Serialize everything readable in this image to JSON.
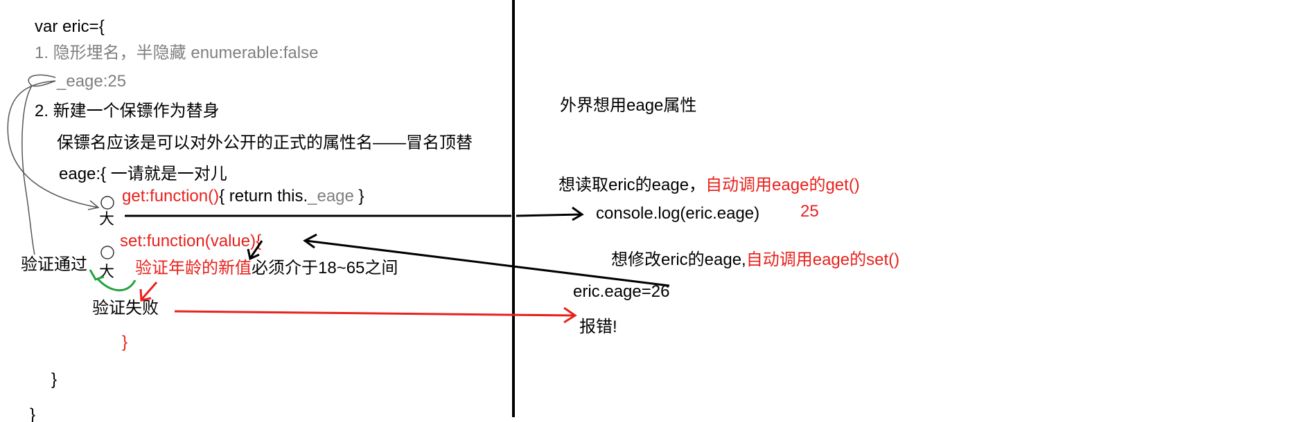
{
  "code": {
    "open": "var eric={",
    "note1": "1. 隐形埋名，半隐藏 enumerable:false",
    "prop": "_eage:25",
    "note2": "2. 新建一个保镖作为替身",
    "note2_detail": "保镖名应该是可以对外公开的正式的属性名——冒名顶替",
    "accessor_open": "eage:{ 一请就是一对儿",
    "getter_prefix": "get:function()",
    "getter_body": "{ return this.",
    "getter_field": "_eage",
    "getter_close": " }",
    "setter": "set:function(value){",
    "validate_red": "验证年龄的新值",
    "validate_black": "必须介于18~65之间",
    "pass_label": "验证通过",
    "fail_label": "验证失败",
    "setter_close": "}",
    "accessor_close": "}",
    "close": "}"
  },
  "outside": {
    "heading": "外界想用eage属性",
    "read_black": "想读取eric的eage，",
    "read_red": "自动调用eage的get()",
    "read_code": "console.log(eric.eage)",
    "read_result": "25",
    "write_black": "想修改eric的eage,",
    "write_red": "自动调用eage的set()",
    "write_code": "eric.eage=26",
    "error": "报错!"
  },
  "figures": {
    "guard_glyph": "大"
  },
  "colors": {
    "text": "#000000",
    "gray": "#7f7f7f",
    "red": "#e8211c",
    "green": "#22a33a"
  }
}
